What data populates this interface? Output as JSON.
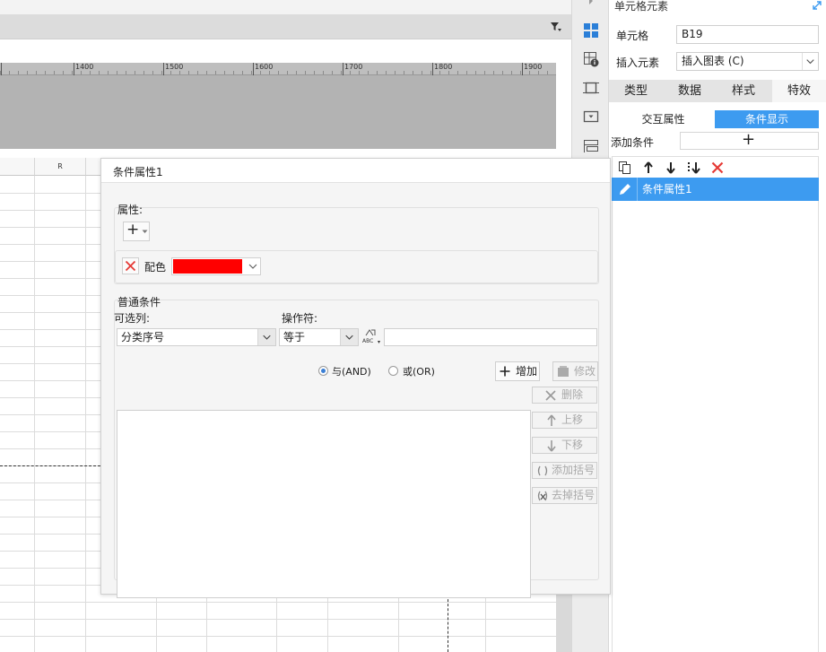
{
  "ruler": {
    "ticks": [
      "1400",
      "1500",
      "1600",
      "1700",
      "1800",
      "1900"
    ]
  },
  "sheet": {
    "column_header": "R"
  },
  "right_panel": {
    "title": "单元格元素",
    "cell_label": "单元格",
    "cell_value": "B19",
    "insert_label": "插入元素",
    "insert_value": "插入图表 (C)",
    "tabs": [
      "类型",
      "数据",
      "样式",
      "特效"
    ],
    "active_tab": "特效",
    "subtabs": {
      "interaction": "交互属性",
      "condition": "条件显示"
    },
    "add_condition_label": "添加条件",
    "add_condition_symbol": "+",
    "condition_items": [
      "条件属性1"
    ]
  },
  "dialog": {
    "title": "条件属性1",
    "attributes_label": "属性:",
    "add_symbol": "+",
    "attribute_row": {
      "name": "配色",
      "color": "#ff0000"
    },
    "general_condition_label": "普通条件",
    "optional_column_label": "可选列:",
    "optional_column_value": "分类序号",
    "operator_label": "操作符:",
    "operator_value": "等于",
    "abc_label": "ABC",
    "value_input": "",
    "radio_and": "与(AND)",
    "radio_or": "或(OR)",
    "add_button": "增加",
    "modify_button": "修改",
    "delete_button": "删除",
    "move_up_button": "上移",
    "move_down_button": "下移",
    "add_bracket_button": "添加括号",
    "remove_bracket_button": "去掉括号"
  },
  "colors": {
    "accent": "#3d9bf0",
    "delete_red": "#e53935",
    "icon_blue": "#2b7fd8",
    "swatch_red": "#ff0000"
  },
  "icons": [
    "filter-dropdown-icon",
    "cell-element-icon",
    "cell-attribute-icon",
    "float-element-icon",
    "widget-settings-icon",
    "form-icon",
    "expand-icon",
    "copy-icon",
    "arrow-up-icon",
    "arrow-down-icon",
    "move-bottom-icon",
    "delete-icon",
    "edit-icon",
    "abc-icon"
  ]
}
